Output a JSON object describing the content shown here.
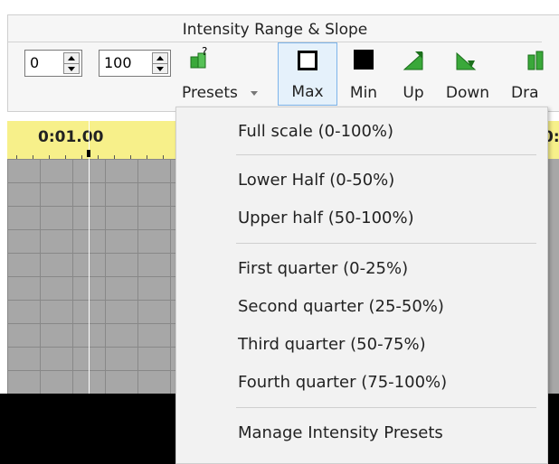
{
  "ribbon": {
    "group_title": "Intensity Range & Slope",
    "spin_min": "0",
    "spin_max": "100",
    "tools": [
      {
        "label": "Presets",
        "icon": "presets-icon"
      },
      {
        "label": "Max",
        "icon": "max-square-icon"
      },
      {
        "label": "Min",
        "icon": "min-square-icon"
      },
      {
        "label": "Up",
        "icon": "ramp-up-icon"
      },
      {
        "label": "Down",
        "icon": "ramp-down-icon"
      },
      {
        "label": "Dra",
        "icon": "draw-icon"
      }
    ]
  },
  "timeline": {
    "time_label": "0:01.00",
    "right_cut_char": "0:"
  },
  "menu": {
    "items": [
      "Full scale (0-100%)",
      "Lower Half (0-50%)",
      "Upper half (50-100%)",
      "First quarter (0-25%)",
      "Second quarter (25-50%)",
      "Third quarter (50-75%)",
      "Fourth quarter (75-100%)",
      "Manage Intensity Presets"
    ]
  },
  "colors": {
    "ruler": "#f7f08a",
    "menu_bg": "#f2f2f2",
    "selected_tool": "#e5f1fb",
    "icon_green": "#3aa83a"
  }
}
